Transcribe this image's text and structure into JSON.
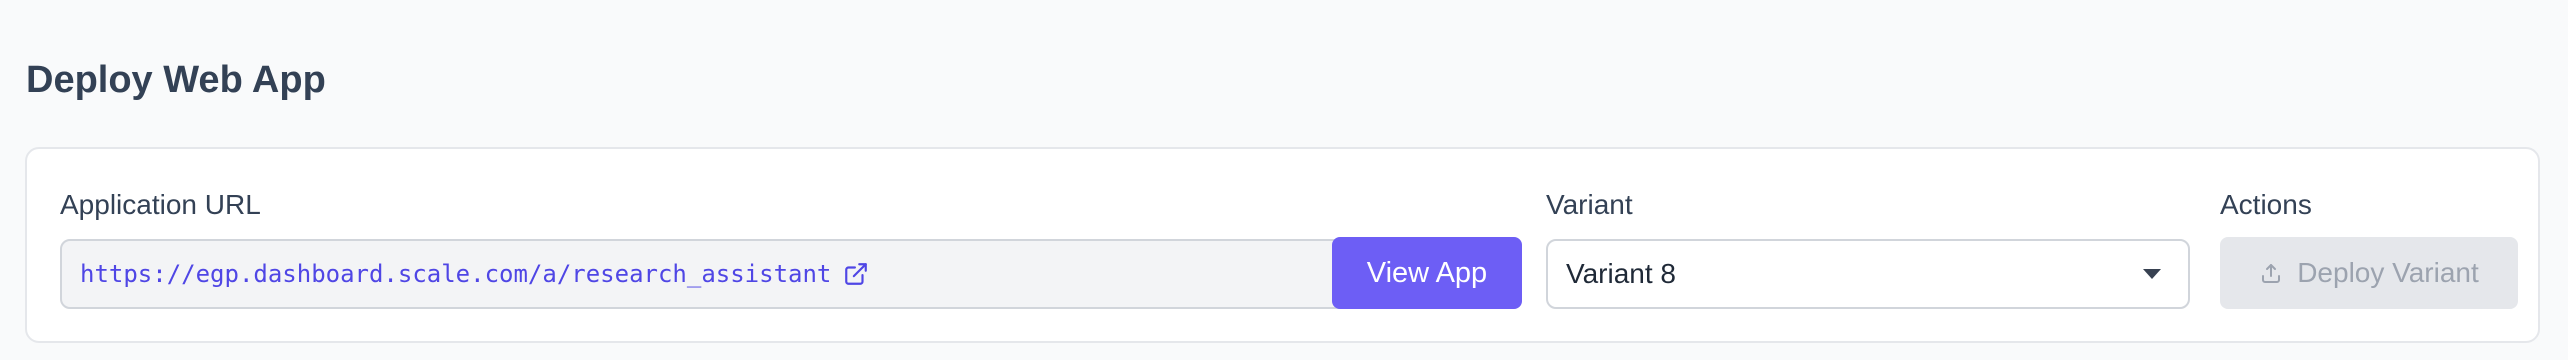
{
  "page": {
    "title": "Deploy Web App"
  },
  "url_section": {
    "label": "Application URL",
    "value": "https://egp.dashboard.scale.com/a/research_assistant",
    "open_icon": "external-link-icon"
  },
  "view_button": {
    "label": "View App"
  },
  "variant_section": {
    "label": "Variant",
    "selected": "Variant 8",
    "caret_icon": "caret-down-icon"
  },
  "actions_section": {
    "label": "Actions",
    "deploy_label": "Deploy Variant",
    "deploy_icon": "upload-icon",
    "deploy_disabled": true
  },
  "colors": {
    "accent": "#6d5ef5",
    "link": "#4f46e5",
    "disabled_bg": "#e5e7eb",
    "disabled_text": "#9ca3af"
  }
}
